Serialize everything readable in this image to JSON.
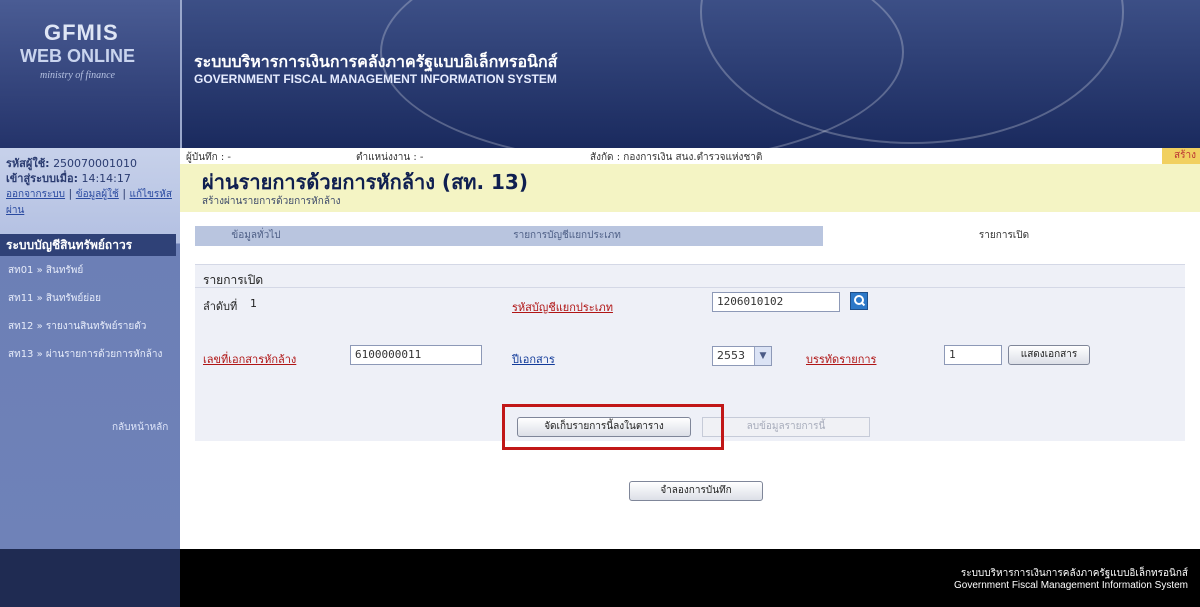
{
  "header": {
    "logo_line1": "GFMIS",
    "logo_line2": "WEB ONLINE",
    "logo_line3": "ministry of finance",
    "system_title_th": "ระบบบริหารการเงินการคลังภาครัฐแบบอิเล็กทรอนิกส์",
    "system_title_en": "GOVERNMENT FISCAL MANAGEMENT INFORMATION SYSTEM"
  },
  "sidebar": {
    "user_code_label": "รหัสผู้ใช้:",
    "user_code": "250070001010",
    "login_time_label": "เข้าสู่ระบบเมื่อ:",
    "login_time": "14:14:17",
    "links": [
      "ออกจากระบบ",
      "ข้อมูลผู้ใช้",
      "แก้ไขรหัสผ่าน"
    ],
    "menu_title": "ระบบบัญชีสินทรัพย์ถาวร",
    "items": [
      {
        "label": "สท01 » สินทรัพย์"
      },
      {
        "label": "สท11 » สินทรัพย์ย่อย"
      },
      {
        "label": "สท12 » รายงานสินทรัพย์รายตัว"
      },
      {
        "label": "สท13 » ผ่านรายการด้วยการหักล้าง"
      }
    ],
    "home_link": "กลับหน้าหลัก"
  },
  "info": {
    "recorder": "ผู้บันทึก : -",
    "position": "ตำแหน่งงาน : -",
    "affiliation": "สังกัด : กองการเงิน สนง.ตำรวจแห่งชาติ",
    "mode": "สร้าง"
  },
  "page": {
    "title": "ผ่านรายการด้วยการหักล้าง (สท. 13)",
    "subtitle": "สร้างผ่านรายการด้วยการหักล้าง"
  },
  "tabs": [
    {
      "label": "ข้อมูลทั่วไป",
      "active": false
    },
    {
      "label": "รายการบัญชีแยกประเภท",
      "active": false
    },
    {
      "label": "รายการเปิด",
      "active": true
    }
  ],
  "form": {
    "section_title": "รายการเปิด",
    "seq_label": "ลำดับที่",
    "seq_value": "1",
    "gl_account_label": "รหัสบัญชีแยกประเภท",
    "gl_account_value": "1206010102",
    "clearing_doc_label": "เลขที่เอกสารหักล้าง",
    "clearing_doc_value": "6100000011",
    "doc_year_label": "ปีเอกสาร",
    "doc_year_value": "2553",
    "line_item_label": "บรรทัดรายการ",
    "line_item_value": "1",
    "show_doc_button": "แสดงเอกสาร",
    "store_button": "จัดเก็บรายการนี้ลงในตาราง",
    "delete_button": "ลบข้อมูลรายการนี้",
    "simulate_button": "จำลองการบันทึก"
  },
  "footer": {
    "line_th": "ระบบบริหารการเงินการคลังภาครัฐแบบอิเล็กทรอนิกส์",
    "line_en": "Government Fiscal Management Information System"
  },
  "colors": {
    "header_blue": "#2a3b70",
    "title_band": "#f4f4c4",
    "highlight_red": "#c11717"
  }
}
